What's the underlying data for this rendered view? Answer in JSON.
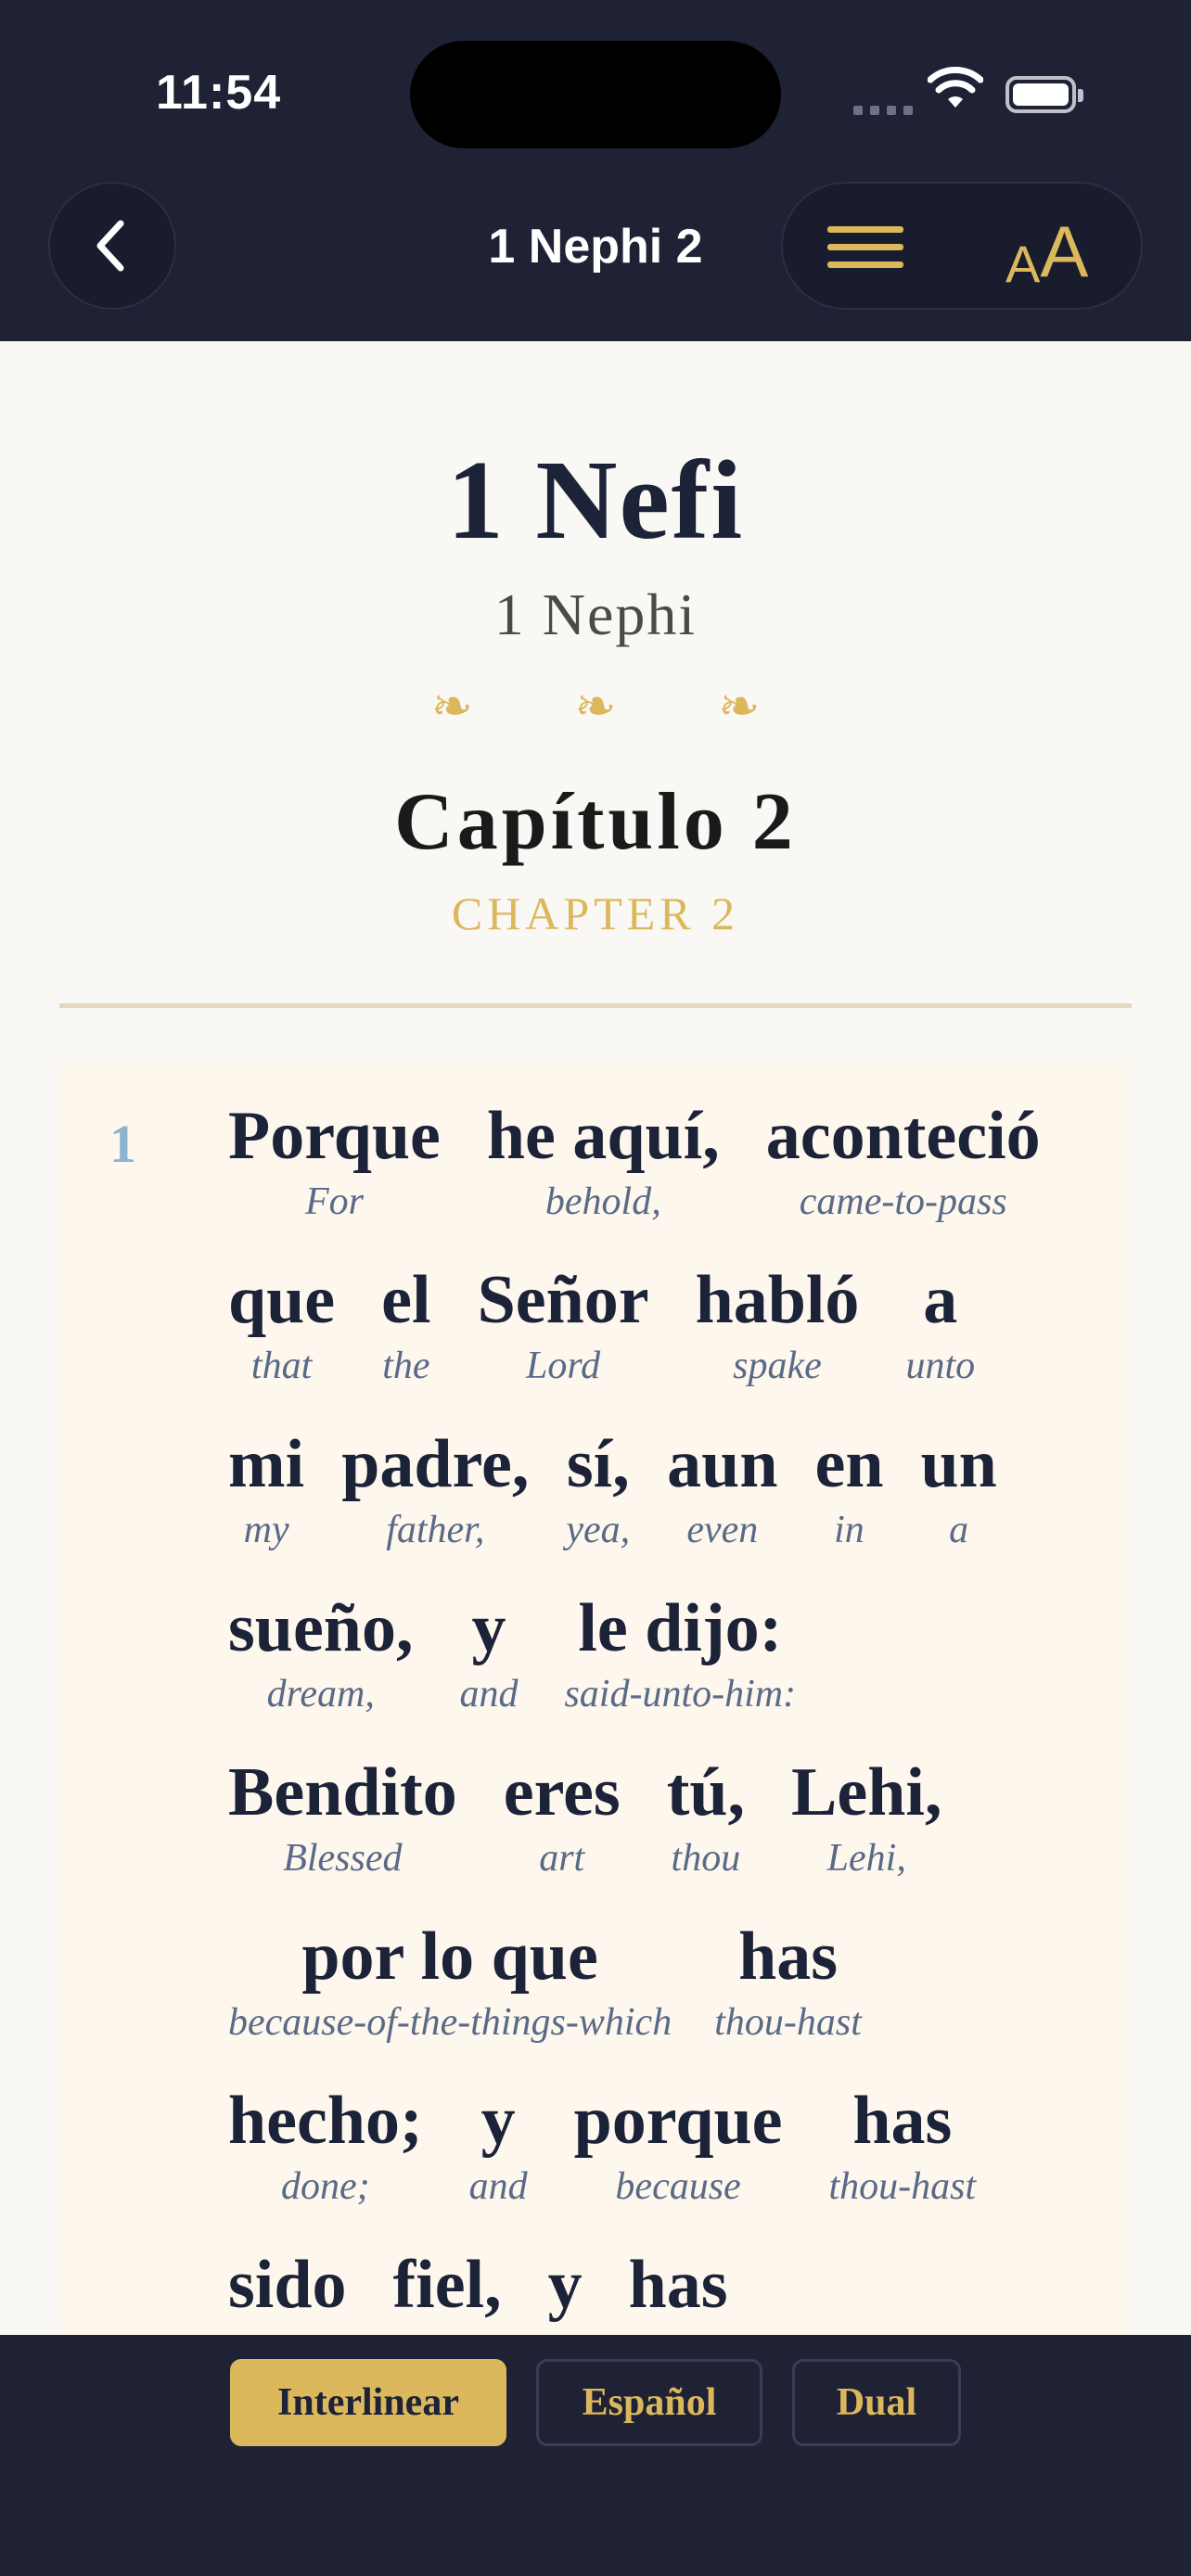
{
  "status": {
    "time": "11:54"
  },
  "nav": {
    "title": "1 Nephi 2",
    "text_size_small": "A",
    "text_size_large": "A"
  },
  "heading": {
    "book_title": "1 Nefi",
    "book_subtitle": "1 Nephi",
    "ornament": "❧ ❧ ❧",
    "chapter_title": "Capítulo 2",
    "chapter_subtitle": "CHAPTER 2"
  },
  "verse": {
    "number": "1",
    "lines": [
      [
        {
          "es": "Porque",
          "en": "For"
        },
        {
          "es": "he aquí,",
          "en": "behold,"
        },
        {
          "es": "aconteció",
          "en": "came-to-pass"
        }
      ],
      [
        {
          "es": "que",
          "en": "that"
        },
        {
          "es": "el",
          "en": "the"
        },
        {
          "es": "Señor",
          "en": "Lord"
        },
        {
          "es": "habló",
          "en": "spake"
        },
        {
          "es": "a",
          "en": "unto"
        }
      ],
      [
        {
          "es": "mi",
          "en": "my"
        },
        {
          "es": "padre,",
          "en": "father,"
        },
        {
          "es": "sí,",
          "en": "yea,"
        },
        {
          "es": "aun",
          "en": "even"
        },
        {
          "es": "en",
          "en": "in"
        },
        {
          "es": "un",
          "en": "a"
        }
      ],
      [
        {
          "es": "sueño,",
          "en": "dream,"
        },
        {
          "es": "y",
          "en": "and"
        },
        {
          "es": "le dijo:",
          "en": "said-unto-him:"
        }
      ],
      [
        {
          "es": "Bendito",
          "en": "Blessed"
        },
        {
          "es": "eres",
          "en": "art"
        },
        {
          "es": "tú,",
          "en": "thou"
        },
        {
          "es": "Lehi,",
          "en": "Lehi,"
        }
      ],
      [
        {
          "es": "por lo que",
          "en": "because-of-the-things-which"
        },
        {
          "es": "has",
          "en": "thou-hast"
        }
      ],
      [
        {
          "es": "hecho;",
          "en": "done;"
        },
        {
          "es": "y",
          "en": "and"
        },
        {
          "es": "porque",
          "en": "because"
        },
        {
          "es": "has",
          "en": "thou-hast"
        }
      ],
      [
        {
          "es": "sido",
          "en": ""
        },
        {
          "es": "fiel,",
          "en": ""
        },
        {
          "es": "y",
          "en": ""
        },
        {
          "es": "has",
          "en": ""
        }
      ]
    ]
  },
  "modes": [
    {
      "label": "Interlinear",
      "active": true
    },
    {
      "label": "Español",
      "active": false
    },
    {
      "label": "Dual",
      "active": false
    }
  ],
  "colors": {
    "accent": "#dcb85c",
    "header_bg": "#1f2235",
    "verse_number": "#8ab4d0"
  }
}
